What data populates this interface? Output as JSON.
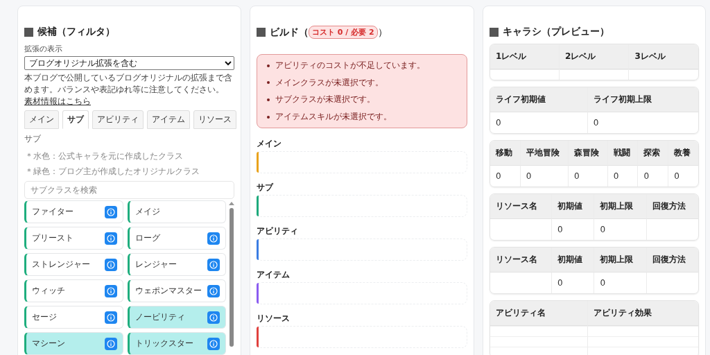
{
  "filter_panel": {
    "title": "候補（フィルタ）",
    "expansion_label": "拡張の表示",
    "expansion_select": {
      "value": "ブログオリジナル拡張を含む"
    },
    "note": "本ブログで公開しているブログオリジナルの拡張まで含めます。バランスや表記ゆれ等に注意してください。",
    "note_link": "素材情報はこちら",
    "tabs": [
      {
        "label": "メイン",
        "selected": false
      },
      {
        "label": "サブ",
        "selected": true
      },
      {
        "label": "アビリティ",
        "selected": false
      },
      {
        "label": "アイテム",
        "selected": false
      },
      {
        "label": "リソース",
        "selected": false
      }
    ],
    "section_label": "サブ",
    "legend": [
      "＊水色：公式キャラを元に作成したクラス",
      "＊緑色：ブログ主が作成したオリジナルクラス"
    ],
    "search": {
      "placeholder": "サブクラスを検索"
    },
    "classes": [
      {
        "name": "ファイター",
        "highlighted": false,
        "info": true
      },
      {
        "name": "メイジ",
        "highlighted": false,
        "info": false
      },
      {
        "name": "プリースト",
        "highlighted": false,
        "info": true
      },
      {
        "name": "ローグ",
        "highlighted": false,
        "info": true
      },
      {
        "name": "ストレンジャー",
        "highlighted": false,
        "info": true
      },
      {
        "name": "レンジャー",
        "highlighted": false,
        "info": true
      },
      {
        "name": "ウィッチ",
        "highlighted": false,
        "info": true
      },
      {
        "name": "ウェポンマスター",
        "highlighted": false,
        "info": true
      },
      {
        "name": "セージ",
        "highlighted": false,
        "info": true
      },
      {
        "name": "ノービリティ",
        "highlighted": true,
        "info": true
      },
      {
        "name": "マシーン",
        "highlighted": true,
        "info": true
      },
      {
        "name": "トリックスター",
        "highlighted": true,
        "info": true
      }
    ]
  },
  "build_panel": {
    "title": "ビルド（",
    "cost_badge": "コスト 0 / 必要 2",
    "title_close": "）",
    "errors": [
      "アビリティのコストが不足しています。",
      "メインクラスが未選択です。",
      "サブクラスが未選択です。",
      "アイテムスキルが未選択です。"
    ],
    "slots": [
      {
        "label": "メイン",
        "color": "#e9a21c"
      },
      {
        "label": "サブ",
        "color": "#1ea97c"
      },
      {
        "label": "アビリティ",
        "color": "#3b7de3"
      },
      {
        "label": "アイテム",
        "color": "#8b5cf0"
      },
      {
        "label": "リソース",
        "color": "#e0413e"
      }
    ]
  },
  "preview_panel": {
    "title": "キャラシ（プレビュー）",
    "tables": [
      {
        "columns": [
          "1レベル",
          "2レベル",
          "3レベル"
        ],
        "rows": [
          [
            null,
            null,
            null
          ]
        ]
      },
      {
        "columns": [
          "ライフ初期値",
          "ライフ初期上限"
        ],
        "rows": [
          [
            "0",
            "0"
          ]
        ]
      },
      {
        "columns": [
          "移動",
          "平地冒険",
          "森冒険",
          "戦闘",
          "探索",
          "教養"
        ],
        "rows": [
          [
            "0",
            "0",
            "0",
            "0",
            "0",
            "0"
          ]
        ]
      },
      {
        "columns": [
          "リソース名",
          "初期値",
          "初期上限",
          "回復方法"
        ],
        "rows": [
          [
            null,
            "0",
            "0",
            null
          ]
        ]
      },
      {
        "columns": [
          "リソース名",
          "初期値",
          "初期上限",
          "回復方法"
        ],
        "rows": [
          [
            null,
            "0",
            "0",
            null
          ]
        ]
      },
      {
        "columns": [
          "アビリティ名",
          "アビリティ効果"
        ],
        "rows": [
          [
            null,
            null
          ],
          [
            null,
            null
          ],
          [
            null,
            null
          ]
        ]
      }
    ]
  }
}
